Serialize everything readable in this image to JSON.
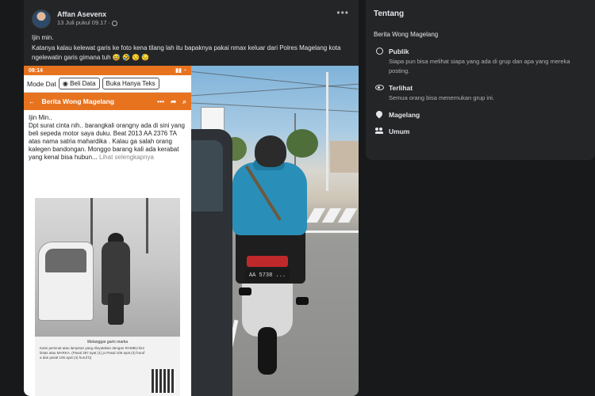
{
  "post": {
    "author": "Affan Asevenx",
    "timestamp": "13 Juli pukul 09.17",
    "privacy_separator": "·",
    "text_lines": [
      "Ijin min.",
      "Katanya kalau kelewat garis ke foto kena tilang lah itu bapaknya pakai nmax keluar dari Polres Magelang kota ngelewatin garis gimana tuh 😅 🤣 😒 😓"
    ],
    "more_icon": "more-horizontal-icon"
  },
  "screenshot": {
    "status_time": "09:14",
    "mode_label": "Mode Dat",
    "beli_data_label": "Beli Data",
    "buka_teks_label": "Buka Hanya Teks",
    "nav_title": "Berita Wong Magelang",
    "body_text": "Ijin Min..\nDpt surat cinta nih.. barangkali orangny ada di sini yang beli sepeda motor saya duku. Beat 2013 AA 2376 TA atas nama satria mahardika . Kalau ga salah orang kalegen bandongan. Monggo barang kali ada kerabat yang kenal bisa hubun",
    "see_more": "Lihat selengkapnya",
    "doc_title": "Melanggar garis marka",
    "doc_text": "Kami peminat atau lampiran yang dinyatakan dengan RAMBU kini lintas atau MARKA. (Pasal 287 ayat (1) jo Pasal 106 ayat (4) huruf a dan pasal 106 ayat (4) huruf b)",
    "accent_color": "#e8731f"
  },
  "photo": {
    "plate": "AA 5738 ..."
  },
  "about": {
    "title": "Tentang",
    "group_name": "Berita Wong Magelang",
    "rows": [
      {
        "icon": "globe-icon",
        "title": "Publik",
        "desc": "Siapa pun bisa melihat siapa yang ada di grup dan apa yang mereka posting."
      },
      {
        "icon": "eye-icon",
        "title": "Terlihat",
        "desc": "Semua orang bisa menemukan grup ini."
      },
      {
        "icon": "location-pin-icon",
        "title": "Magelang",
        "desc": ""
      },
      {
        "icon": "people-icon",
        "title": "Umum",
        "desc": ""
      }
    ]
  }
}
